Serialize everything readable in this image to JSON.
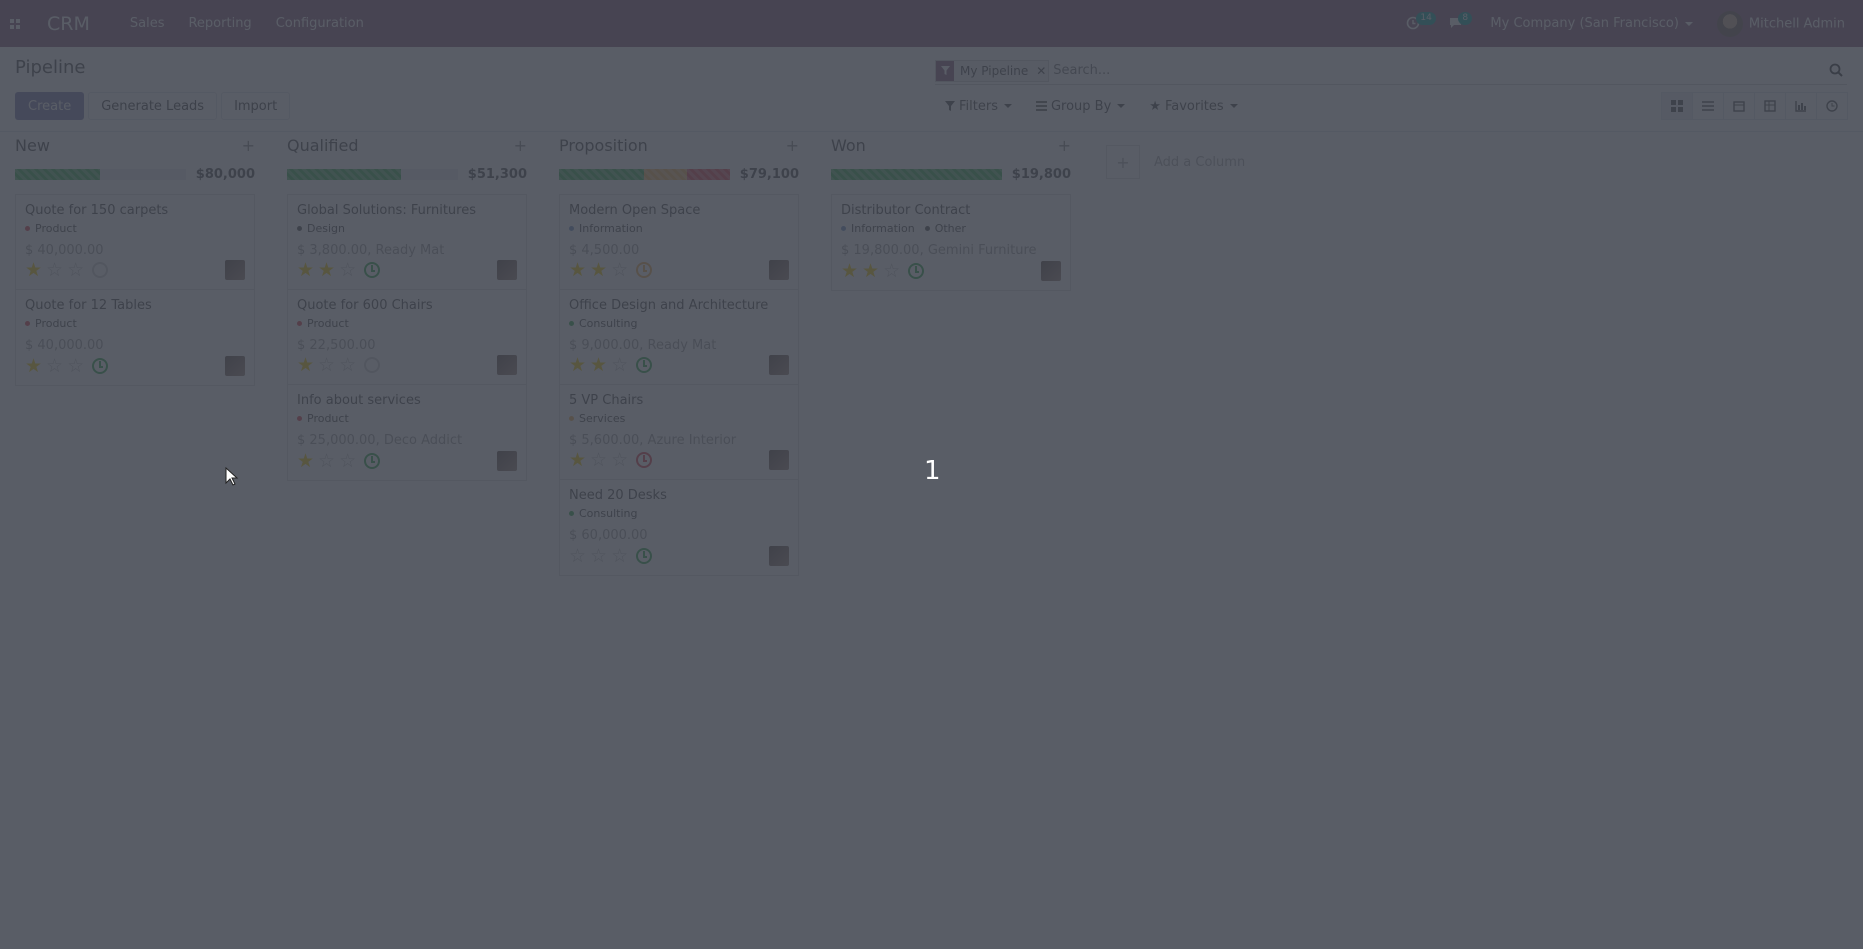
{
  "navbar": {
    "brand": "CRM",
    "menu": [
      "Sales",
      "Reporting",
      "Configuration"
    ],
    "activity_count": "14",
    "message_count": "8",
    "company": "My Company (San Francisco)",
    "user": "Mitchell Admin"
  },
  "control_panel": {
    "breadcrumb": "Pipeline",
    "buttons": {
      "create": "Create",
      "generate": "Generate Leads",
      "import": "Import"
    },
    "search": {
      "facet": "My Pipeline",
      "placeholder": "Search..."
    },
    "filters": {
      "filters": "Filters",
      "group_by": "Group By",
      "favorites": "Favorites"
    }
  },
  "columns": [
    {
      "title": "New",
      "total": "$80,000",
      "progress": [
        {
          "color": "#28a745",
          "pct": 0.5
        }
      ],
      "cards": [
        {
          "title": "Quote for 150 carpets",
          "tags": [
            {
              "label": "Product",
              "color": "#dc3545"
            }
          ],
          "info": "$ 40,000.00",
          "stars": 1,
          "activity": "empty"
        },
        {
          "title": "Quote for 12 Tables",
          "tags": [
            {
              "label": "Product",
              "color": "#dc3545"
            }
          ],
          "info": "$ 40,000.00",
          "stars": 1,
          "activity": "#28a745"
        }
      ]
    },
    {
      "title": "Qualified",
      "total": "$51,300",
      "progress": [
        {
          "color": "#28a745",
          "pct": 0.67
        }
      ],
      "cards": [
        {
          "title": "Global Solutions: Furnitures",
          "tags": [
            {
              "label": "Design",
              "color": "#4c4c4c"
            }
          ],
          "info": "$ 3,800.00, Ready Mat",
          "stars": 2,
          "activity": "#28a745"
        },
        {
          "title": "Quote for 600 Chairs",
          "tags": [
            {
              "label": "Product",
              "color": "#dc3545"
            }
          ],
          "info": "$ 22,500.00",
          "stars": 1,
          "activity": "empty"
        },
        {
          "title": "Info about services",
          "tags": [
            {
              "label": "Product",
              "color": "#dc3545"
            }
          ],
          "info": "$ 25,000.00, Deco Addict",
          "stars": 1,
          "activity": "#28a745"
        }
      ]
    },
    {
      "title": "Proposition",
      "total": "$79,100",
      "progress": [
        {
          "color": "#28a745",
          "pct": 0.5
        },
        {
          "color": "#f0ad4e",
          "pct": 0.25
        },
        {
          "color": "#dc3545",
          "pct": 0.25
        }
      ],
      "cards": [
        {
          "title": "Modern Open Space",
          "tags": [
            {
              "label": "Information",
              "color": "#6c8fbf"
            }
          ],
          "info": "$ 4,500.00",
          "stars": 2,
          "activity": "#f0ad4e"
        },
        {
          "title": "Office Design and Architecture",
          "tags": [
            {
              "label": "Consulting",
              "color": "#28a745"
            }
          ],
          "info": "$ 9,000.00, Ready Mat",
          "stars": 2,
          "activity": "#28a745"
        },
        {
          "title": "5 VP Chairs",
          "tags": [
            {
              "label": "Services",
              "color": "#f0ad4e"
            }
          ],
          "info": "$ 5,600.00, Azure Interior",
          "stars": 1,
          "activity": "#dc3545"
        },
        {
          "title": "Need 20 Desks",
          "tags": [
            {
              "label": "Consulting",
              "color": "#28a745"
            }
          ],
          "info": "$ 60,000.00",
          "stars": 0,
          "activity": "#28a745"
        }
      ]
    },
    {
      "title": "Won",
      "total": "$19,800",
      "progress": [
        {
          "color": "#28a745",
          "pct": 1.0
        }
      ],
      "cards": [
        {
          "title": "Distributor Contract",
          "tags": [
            {
              "label": "Information",
              "color": "#6c8fbf"
            },
            {
              "label": "Other",
              "color": "#4c4c4c"
            }
          ],
          "info": "$ 19,800.00, Gemini Furniture",
          "stars": 2,
          "activity": "#28a745"
        }
      ]
    }
  ],
  "add_column": "Add a Column",
  "overlay_number": "1",
  "colors": {
    "brand": "#875a7b",
    "primary": "#7c7bad",
    "star": "#f3cc00"
  }
}
